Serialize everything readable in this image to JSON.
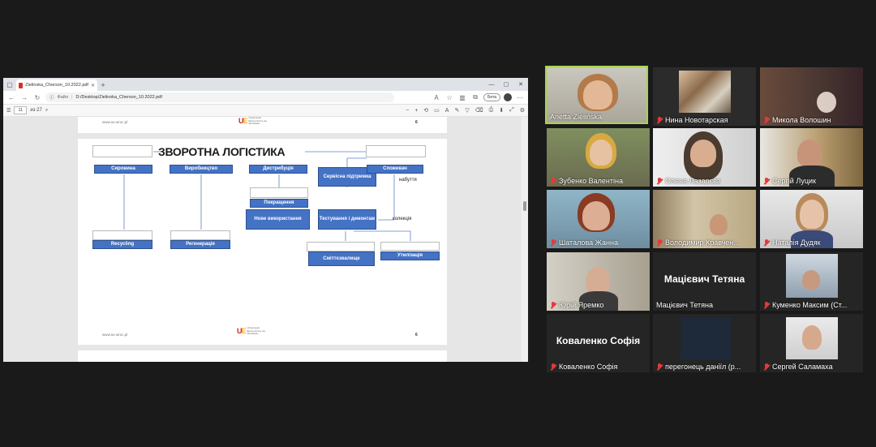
{
  "browser": {
    "tab_title": "Zielinska_Cherson_10.2022.pdf",
    "address_label": "Файл",
    "address_path": "D:/Desktop/Zielinska_Cherson_10.2022.pdf",
    "ext_pill": "Бета",
    "page_current": "11",
    "page_total": "из 27"
  },
  "pdf": {
    "footer_url": "www.ue.wroc.pl",
    "footer_page": "6",
    "logo_letters": "UE",
    "logo_text": "Uniwersytet Ekonomiczny we Wrocławiu"
  },
  "diagram": {
    "title": "ЗВОРОТНА ЛОГІСТИКА",
    "boxes": {
      "syrovyna": "Сировина",
      "vyrobnytstvo": "Виробництво",
      "dystrybutsiia": "Дистрибуція",
      "servisna": "Сервісна підтримка",
      "spozhyvach": "Споживач",
      "pokrashchennia": "Покращення",
      "nove": "Нове використання",
      "testuvannia": "Тестування і демонтаж",
      "recycling": "Recycling",
      "rehemeratsiia": "Регенерація",
      "smittezvalyshche": "Сміттєзвалище",
      "utylizatsiia": "Утилізація"
    },
    "labels": {
      "nabuttia": "набуття",
      "kolektsiia": "колекція"
    }
  },
  "participants": [
    {
      "name": "Anetta Zielińska",
      "muted": false,
      "active": true
    },
    {
      "name": "Нина Новотарская",
      "muted": true
    },
    {
      "name": "Микола Волошин",
      "muted": true
    },
    {
      "name": "Зубенко Валентіна",
      "muted": true
    },
    {
      "name": "Олена Лазарєва",
      "muted": true
    },
    {
      "name": "Сергій Луцик",
      "muted": true
    },
    {
      "name": "Шаталова Жанна",
      "muted": true
    },
    {
      "name": "Володимир Кравчен...",
      "muted": true
    },
    {
      "name": "Наталія Дудяк",
      "muted": true
    },
    {
      "name": "Юрій Яремко",
      "muted": true
    },
    {
      "name": "Мацієвич Тетяна",
      "muted": false,
      "big": "Мацієвич Тетяна"
    },
    {
      "name": "Куменко Максим (Ст...",
      "muted": true
    },
    {
      "name": "Коваленко Софія",
      "muted": true,
      "big": "Коваленко Софія"
    },
    {
      "name": "перегонець даніїл (р...",
      "muted": true
    },
    {
      "name": "Сергей Саламаха",
      "muted": true
    }
  ]
}
